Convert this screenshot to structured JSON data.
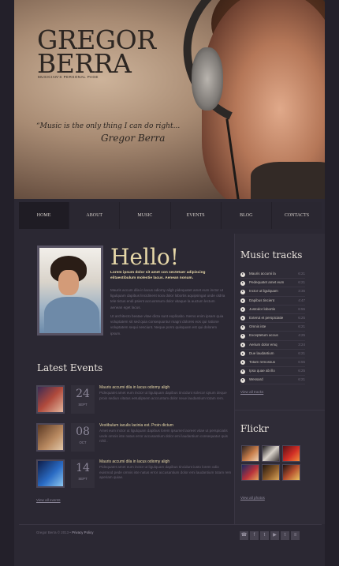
{
  "hero": {
    "name_line1": "GREGOR",
    "name_line2": "BERRA",
    "tagline": "MUSICIAN'S PERSONAL PAGE",
    "quote": "“Music is the only thing I can do right...",
    "signature": "Gregor Berra"
  },
  "nav": {
    "items": [
      "HOME",
      "ABOUT",
      "MUSIC",
      "EVENTS",
      "BLOG",
      "CONTACTS"
    ],
    "active": "HOME"
  },
  "intro": {
    "heading": "Hello!",
    "lead": "Lorem ipsum dolor sit amet con sectetuer adipiscing elitaestibulum molestie lacus. Aenean nonum.",
    "para1": "Mauris accum dila in lacus odiomy aligh pidequatet amet eum inctor ut ligulquam dapibus lincidinent sora dolor lobortis aquipsingat unde oldria tele tictus endi psient accuomsum dolor vitaque la auctum lectum aenean eget lacus.",
    "para2": "Ut architecto beatae vitae dicta sunt explicabo. Nemo enim ipsam quia voluptatem sit sed quia consequuntur magni dolores eos qui ratione voluptatem sequi nesciunt. Neque porro quisquam est qui dolorem ipsum."
  },
  "events": {
    "heading": "Latest Events",
    "items": [
      {
        "day": "24",
        "month": "SEPT",
        "title": "Mauris accumi dila in lacus odiomy aligh",
        "desc": "Pidequatet amet eum inctor ut ligulquam dapibus tincidunt solecor iqsum deque proin sediun vitatus eetudipsem acccuntum dolor neue laudantium totam rem."
      },
      {
        "day": "08",
        "month": "OCT",
        "title": "Vestibulum iaculis lacinia est. Proin dictum",
        "desc": "Amet eum inctor ut ligulquam dapibus lorem ipsumet laoreet vitae ut perspiciatis unde omnis iste natus error accusantium dolor emi laudantium consequatur quis nihil.."
      },
      {
        "day": "14",
        "month": "SEPT",
        "title": "Mauris accumi dila in lacus odiomy aligh",
        "desc": "Pidequatet amet eum inctor ut ligulquam dapibus tincidunt iusto lorem odio euismod pede omnis iste natus error accusantium dolor emi laudantium totam rem aperiam quiae."
      }
    ],
    "view_all": "View all events"
  },
  "tracks": {
    "heading": "Music tracks",
    "items": [
      {
        "name": "Mauris accumi la",
        "time": "6:21"
      },
      {
        "name": "Pedequatet amet eum",
        "time": "6:21"
      },
      {
        "name": "Inctor ut ligulquam",
        "time": "3:35"
      },
      {
        "name": "Dapibus tincient",
        "time": "4:47"
      },
      {
        "name": "Justodor lobortis",
        "time": "6:55"
      },
      {
        "name": "Exterut et perspiciatie",
        "time": "6:25"
      },
      {
        "name": "Omnis iste",
        "time": "6:21"
      },
      {
        "name": "Exceptetum accus",
        "time": "4:25"
      },
      {
        "name": "Aerium dolor emq",
        "time": "3:24"
      },
      {
        "name": "Due laudantium",
        "time": "6:21"
      },
      {
        "name": "Totam remossus",
        "time": "6:55"
      },
      {
        "name": "Ipsa quae ab illo",
        "time": "6:25"
      },
      {
        "name": "Wessard",
        "time": "6:21"
      }
    ],
    "view_all": "View all tracks"
  },
  "flickr": {
    "heading": "Flickr",
    "view_all": "View all photos"
  },
  "footer": {
    "copyright": "Gregor Berra © 2013 •",
    "privacy": "Privacy Policy",
    "socials": [
      "☎",
      "f",
      "t",
      "▶",
      "t",
      "≡"
    ]
  }
}
